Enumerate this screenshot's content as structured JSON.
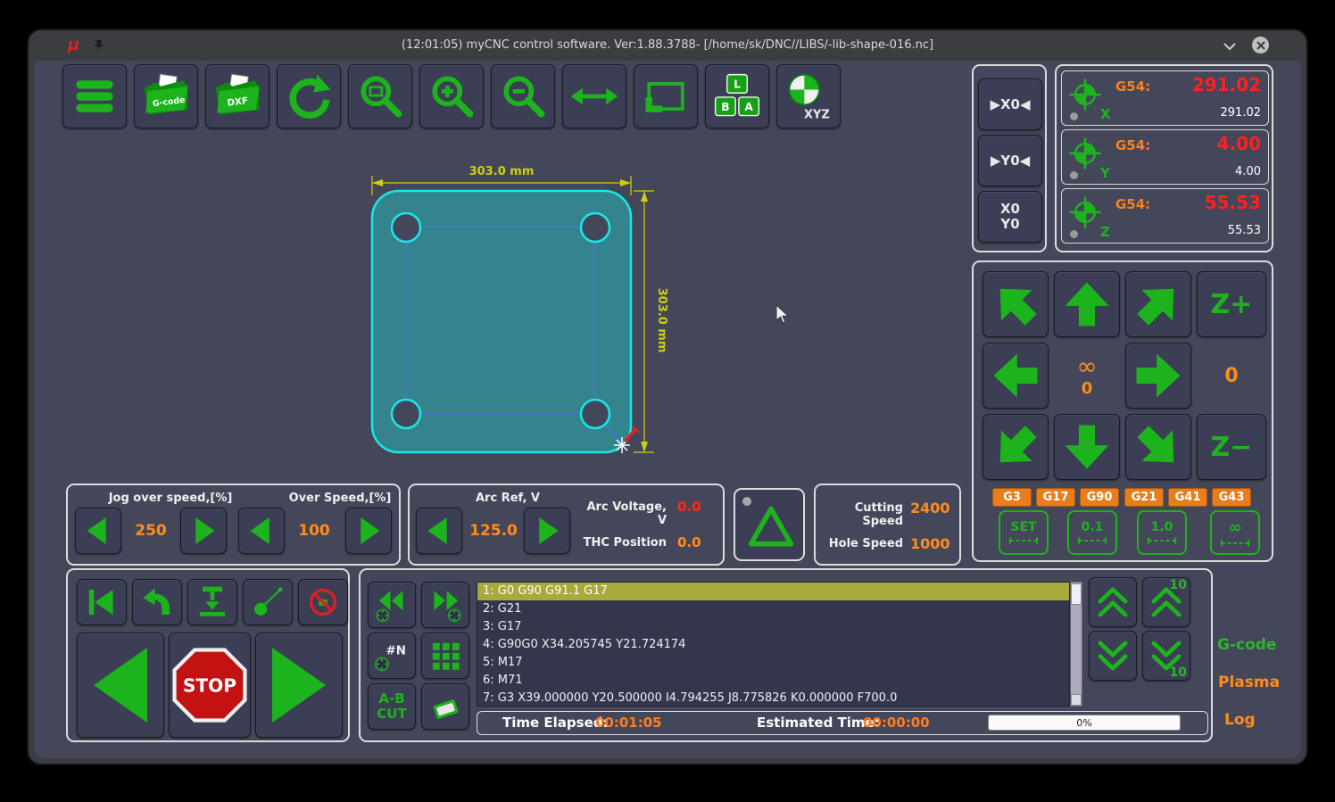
{
  "colors": {
    "green": "#1db31d",
    "orange": "#ff8c1a",
    "red": "#ff2020",
    "cyan": "#17e8e8",
    "tab_orange": "#e87d1e",
    "highlight_row": "#a9a93c"
  },
  "titlebar": {
    "logo": "μ",
    "title": "(12:01:05) myCNC control software. Ver:1.88.3788- [/home/sk/DNC//LIBS/-lib-shape-016.nc]"
  },
  "toolbar": {
    "gcode_label": "G-code",
    "dxf_label": "DXF",
    "keys": {
      "l": "L",
      "b": "B",
      "a": "A"
    },
    "xyz_label": "XYZ"
  },
  "dro": {
    "zero_x": "▶X0◀",
    "zero_y": "▶Y0◀",
    "zero_xy_1": "X0",
    "zero_xy_2": "Y0",
    "axes": [
      {
        "letter": "X",
        "wcs": "G54:",
        "pos": "291.02",
        "mach": "291.02"
      },
      {
        "letter": "Y",
        "wcs": "G54:",
        "pos": "4.00",
        "mach": "4.00"
      },
      {
        "letter": "Z",
        "wcs": "G54:",
        "pos": "55.53",
        "mach": "55.53"
      }
    ]
  },
  "jog": {
    "infinity": "∞",
    "step_display": "0",
    "rotary_display": "0",
    "z_plus": "Z+",
    "z_minus": "Z−",
    "modal_tabs": [
      "G3",
      "G17",
      "G90",
      "G21",
      "G41",
      "G43"
    ],
    "step_buttons": [
      "SET",
      "0.1",
      "1.0",
      "∞"
    ]
  },
  "speeds": {
    "jog_over_label": "Jog over speed,[%]",
    "jog_over_value": "250",
    "over_label": "Over Speed,[%]",
    "over_value": "100",
    "arc_ref_label": "Arc Ref, V",
    "arc_ref_value": "125.0",
    "arc_voltage_label": "Arc Voltage, V",
    "arc_voltage_value": "0.0",
    "thc_label": "THC Position",
    "thc_value": "0.0",
    "cutting_label": "Cutting Speed",
    "cutting_value": "2400",
    "hole_label": "Hole Speed",
    "hole_value": "1000"
  },
  "canvas": {
    "width_dim": "303.0 mm",
    "height_dim": "303.0 mm"
  },
  "transport": {
    "stop": "STOP"
  },
  "gcode": {
    "hash_n": "#N",
    "ab_1": "A-B",
    "ab_2": "CUT",
    "lines": [
      "1: G0 G90 G91.1 G17",
      "2: G21",
      "3: G17",
      "4: G90G0 X34.205745 Y21.724174",
      "5: M17",
      "6: M71",
      "7: G3 X39.000000 Y20.500000 I4.794255 J8.775826 K0.000000 F700.0"
    ],
    "selected_index": 0,
    "time_elapsed_label": "Time Elapsed:",
    "time_elapsed_value": "00:01:05",
    "estimated_label": "Estimated Time:",
    "estimated_value": "00:00:00",
    "progress": "0%"
  },
  "side": {
    "step_up": "10",
    "step_down": "10",
    "tab_gcode": "G-code",
    "tab_plasma": "Plasma",
    "tab_log": "Log"
  }
}
